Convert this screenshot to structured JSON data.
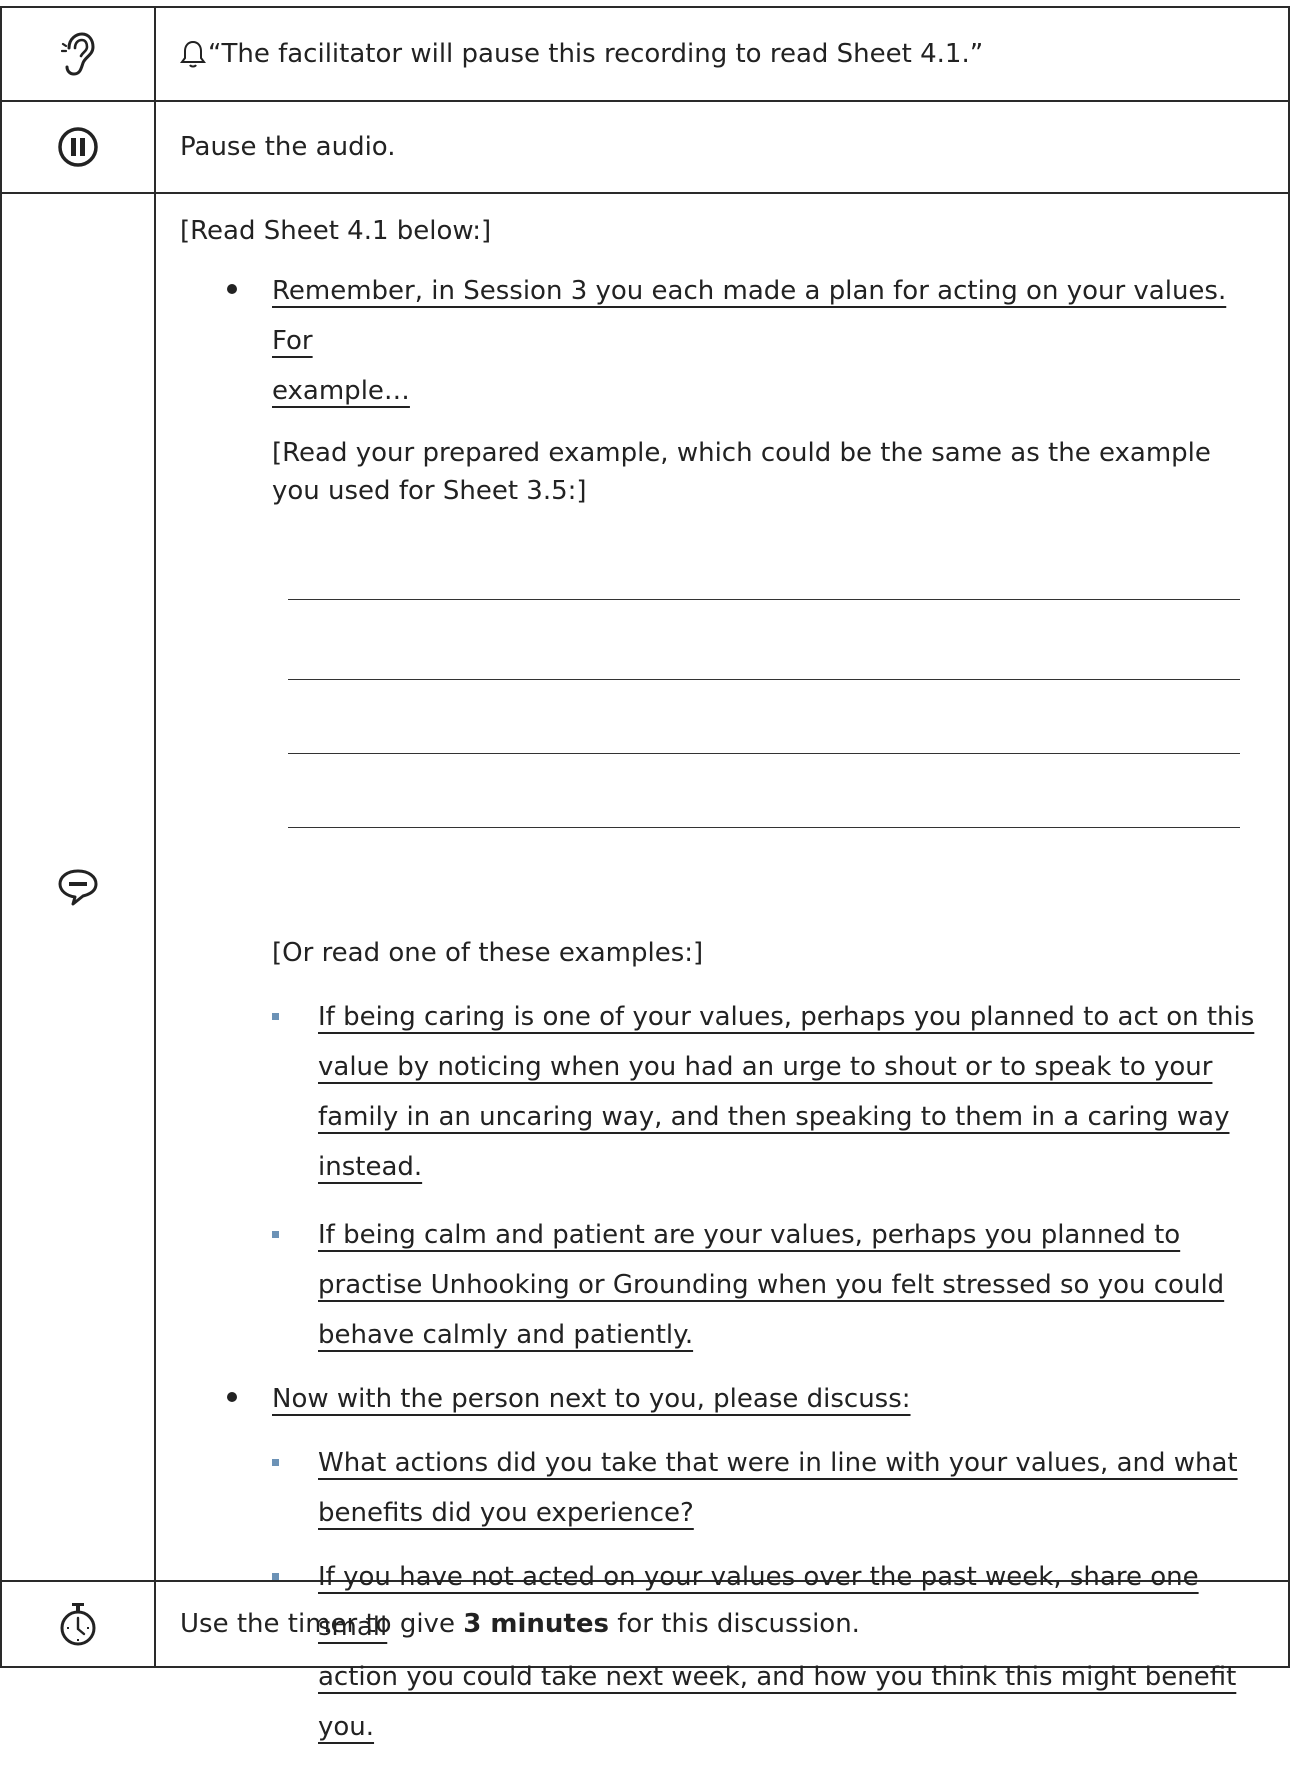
{
  "rows": {
    "listen": {
      "icon": "ear-icon",
      "text": "“The facilitator will pause this recording to read Sheet 4.1.”"
    },
    "pause": {
      "icon": "pause-icon",
      "text": "Pause the audio."
    },
    "speak": {
      "icon": "speech-bubble-icon",
      "intro": "[Read Sheet 4.1 below:]",
      "bullet1_line1": "Remember, in Session 3 you each made a plan for acting on your values. For",
      "bullet1_line2": "example…",
      "prepared_note_line1": "[Read your prepared example, which could be the same as the example",
      "prepared_note_line2": "you used for Sheet 3.5:]",
      "or_note": "[Or read one of these examples:]",
      "ex1_l1": "If being caring is one of your values, perhaps you planned to act on this",
      "ex1_l2": "value by noticing when you had an urge to shout or to speak to your",
      "ex1_l3": "family in an uncaring way, and then speaking to them in a caring way",
      "ex1_l4": "instead.",
      "ex2_l1": "If being calm and patient are your values, perhaps you planned to",
      "ex2_l2": "practise Unhooking or Grounding when you felt stressed so you could",
      "ex2_l3": "behave calmly and patiently.",
      "bullet2": "Now with the person next to you, please discuss:",
      "q1_l1": "What actions did you take that were in line with your values, and what",
      "q1_l2": "benefits did you experience?",
      "q2_l1": "If you have not acted on your values over the past week, share one small",
      "q2_l2": "action you could take next week, and how you think this might benefit",
      "q2_l3": "you."
    },
    "timer": {
      "icon": "stopwatch-icon",
      "before": "Use the timer to give ",
      "bold": "3 minutes",
      "after": " for this discussion."
    }
  },
  "colors": {
    "border": "#2a2a2a",
    "sub_bullet": "#6c92b6",
    "text": "#222222"
  }
}
